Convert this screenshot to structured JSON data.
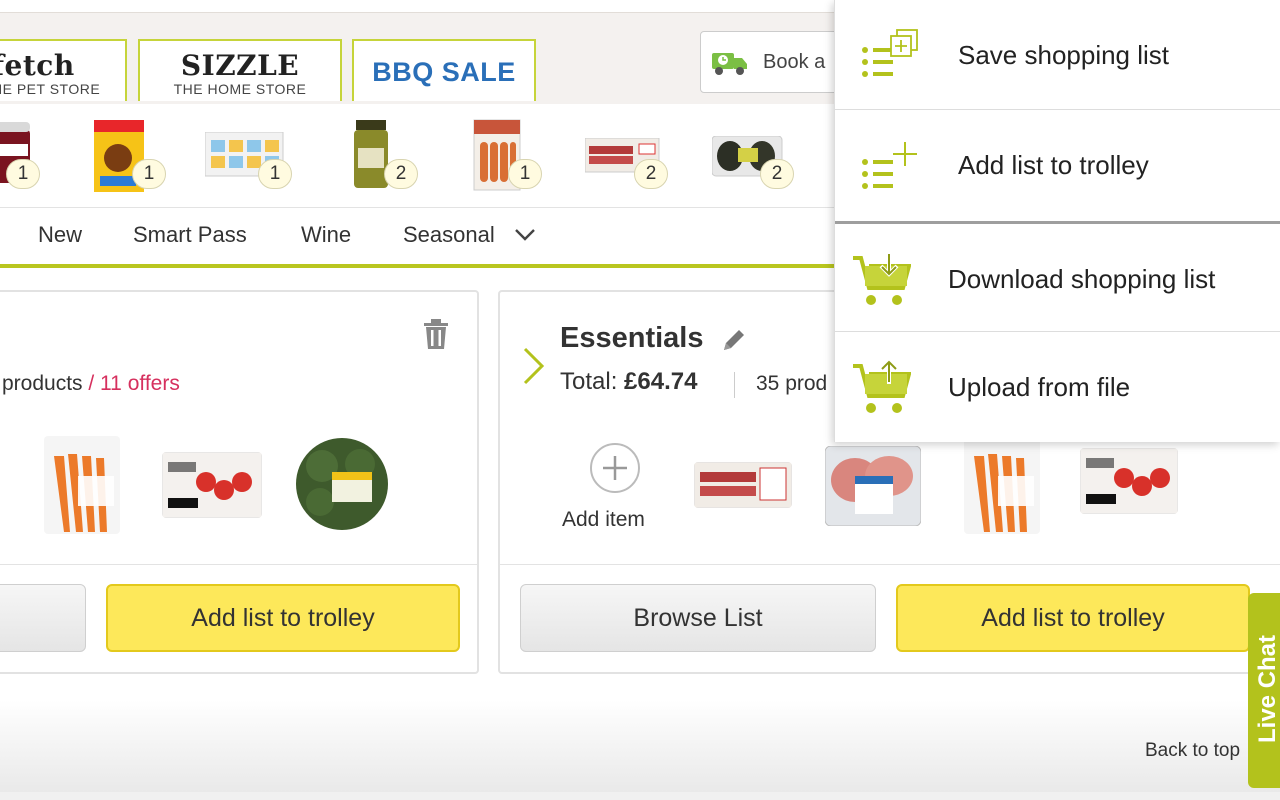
{
  "brands": [
    {
      "name": "fetch",
      "tagline": "HE PET STORE"
    },
    {
      "name": "SIZZLE",
      "tagline": "THE HOME STORE"
    },
    {
      "name": "BBQ SALE"
    }
  ],
  "delivery": {
    "label": "Book a"
  },
  "recent_products": [
    {
      "name": "Dess ice cream",
      "qty": "1"
    },
    {
      "name": "Coco Pops",
      "qty": "1"
    },
    {
      "name": "Snack pack",
      "qty": "1"
    },
    {
      "name": "Pesto jar",
      "qty": "2"
    },
    {
      "name": "Sausages",
      "qty": "1"
    },
    {
      "name": "Bacon",
      "qty": "2"
    },
    {
      "name": "Avocados",
      "qty": "2"
    }
  ],
  "nav": [
    "New",
    "Smart Pass",
    "Wine",
    "Seasonal"
  ],
  "left_card": {
    "products_text": "products",
    "offers_text": "/ 11 offers",
    "add_label": "Add list to trolley",
    "products": [
      "Carrots",
      "Cherry tomatoes",
      "Broccoli"
    ]
  },
  "right_card": {
    "title": "Essentials",
    "total_label": "Total:",
    "total_value": "£64.74",
    "products_count": "35 prod",
    "add_item": "Add item",
    "browse_label": "Browse List",
    "add_label": "Add list to trolley",
    "products": [
      "Bacon",
      "Lamb chops",
      "Carrots",
      "Cherry tomatoes"
    ]
  },
  "menu": [
    {
      "label": "Save shopping list",
      "icon": "save-list-icon"
    },
    {
      "label": "Add list to trolley",
      "icon": "add-list-icon"
    },
    {
      "label": "Download shopping list",
      "icon": "download-trolley-icon"
    },
    {
      "label": "Upload from file",
      "icon": "upload-trolley-icon"
    }
  ],
  "footer": {
    "back_to_top": "Back to top",
    "live_chat": "Live Chat"
  },
  "colors": {
    "accent": "#b9c61f",
    "offer": "#d6305e",
    "button_yellow": "#fde85a",
    "menu_icon": "#b3c21c"
  }
}
